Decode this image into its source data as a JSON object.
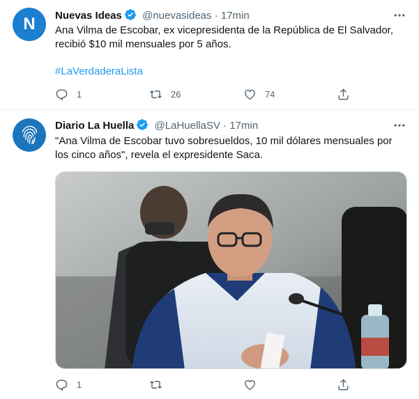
{
  "tweets": [
    {
      "name": "Nuevas Ideas",
      "handle": "@nuevasideas",
      "separator": "·",
      "time": "17min",
      "avatar_letter": "N",
      "text": "Ana Vilma de Escobar, ex vicepresidenta de la República de El Salvador, recibió $10 mil mensuales por 5 años.",
      "hashtag": "#LaVerdaderaLista",
      "replies": "1",
      "retweets": "26",
      "likes": "74"
    },
    {
      "name": "Diario La Huella",
      "handle": "@LaHuellaSV",
      "separator": "·",
      "time": "17min",
      "text": "\"Ana Vilma de Escobar tuvo sobresueldos, 10 mil dólares mensuales por los cinco años\", revela el expresidente Saca.",
      "replies": "1",
      "retweets": "",
      "likes": ""
    }
  ],
  "colors": {
    "accent": "#1d9bf0",
    "secondary_text": "#536471",
    "primary_text": "#0f1419",
    "avatar_blue": "#1d7fd0"
  },
  "icons": [
    "verified-badge-icon",
    "more-options-icon",
    "reply-icon",
    "retweet-icon",
    "like-icon",
    "share-icon",
    "fingerprint-logo-icon"
  ]
}
